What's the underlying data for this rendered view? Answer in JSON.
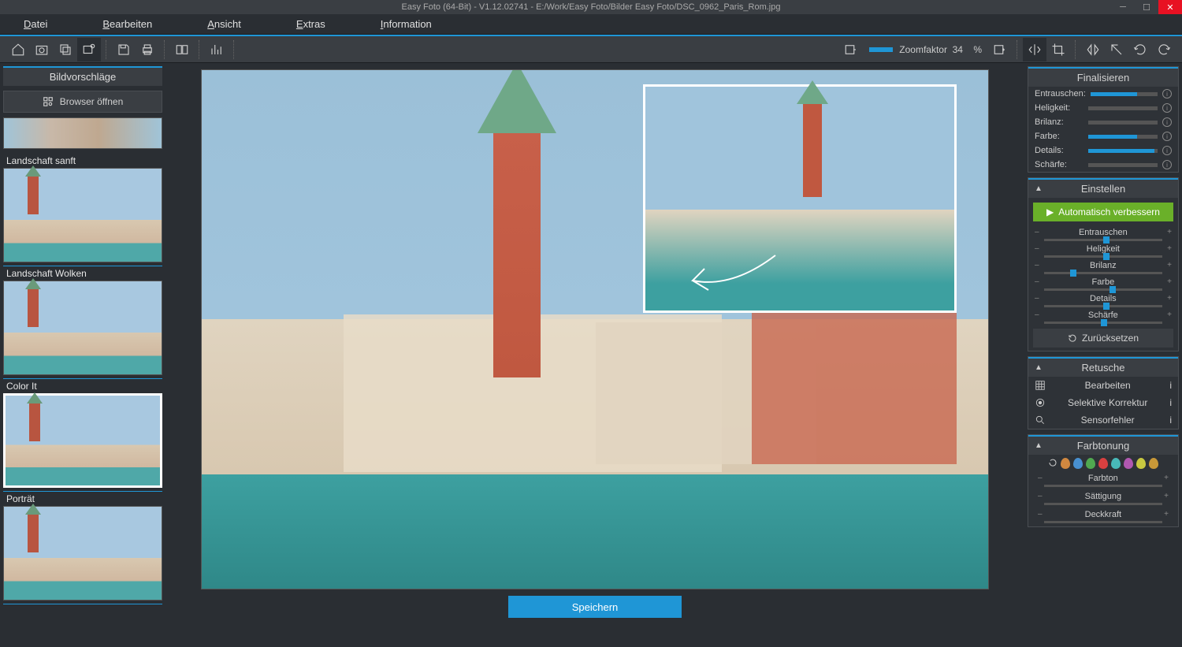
{
  "titlebar": {
    "text": "Easy Foto (64-Bit) - V1.12.02741 - E:/Work/Easy Foto/Bilder Easy Foto/DSC_0962_Paris_Rom.jpg"
  },
  "menu": {
    "items": [
      "Datei",
      "Bearbeiten",
      "Ansicht",
      "Extras",
      "Information"
    ]
  },
  "toolbar": {
    "zoom_label": "Zoomfaktor",
    "zoom_value": "34",
    "zoom_unit": "%"
  },
  "left": {
    "header": "Bildvorschläge",
    "browser_btn": "Browser öffnen",
    "presets": [
      "Landschaft sanft",
      "Landschaft Wolken",
      "Color It",
      "Porträt"
    ]
  },
  "bottom": {
    "save": "Speichern"
  },
  "finalize": {
    "header": "Finalisieren",
    "rows": [
      {
        "label": "Entrauschen:",
        "fill": 70
      },
      {
        "label": "Heligkeit:",
        "fill": 0
      },
      {
        "label": "Brilanz:",
        "fill": 0
      },
      {
        "label": "Farbe:",
        "fill": 70
      },
      {
        "label": "Details:",
        "fill": 95
      },
      {
        "label": "Schärfe:",
        "fill": 0
      }
    ]
  },
  "adjust": {
    "header": "Einstellen",
    "auto": "Automatisch verbessern",
    "sliders": [
      {
        "label": "Entrauschen",
        "pos": 50
      },
      {
        "label": "Heligkeit",
        "pos": 50
      },
      {
        "label": "Brilanz",
        "pos": 22
      },
      {
        "label": "Farbe",
        "pos": 55
      },
      {
        "label": "Details",
        "pos": 50
      },
      {
        "label": "Schärfe",
        "pos": 48
      }
    ],
    "reset": "Zurücksetzen"
  },
  "retouch": {
    "header": "Retusche",
    "items": [
      "Bearbeiten",
      "Selektive Korrektur",
      "Sensorfehler"
    ]
  },
  "toning": {
    "header": "Farbtonung",
    "drops": [
      "#d08840",
      "#4890d0",
      "#50a850",
      "#d84040",
      "#48b8b8",
      "#b058b0",
      "#c8c840",
      "#c89838"
    ],
    "rows": [
      "Farbton",
      "Sättigung",
      "Deckkraft"
    ]
  }
}
